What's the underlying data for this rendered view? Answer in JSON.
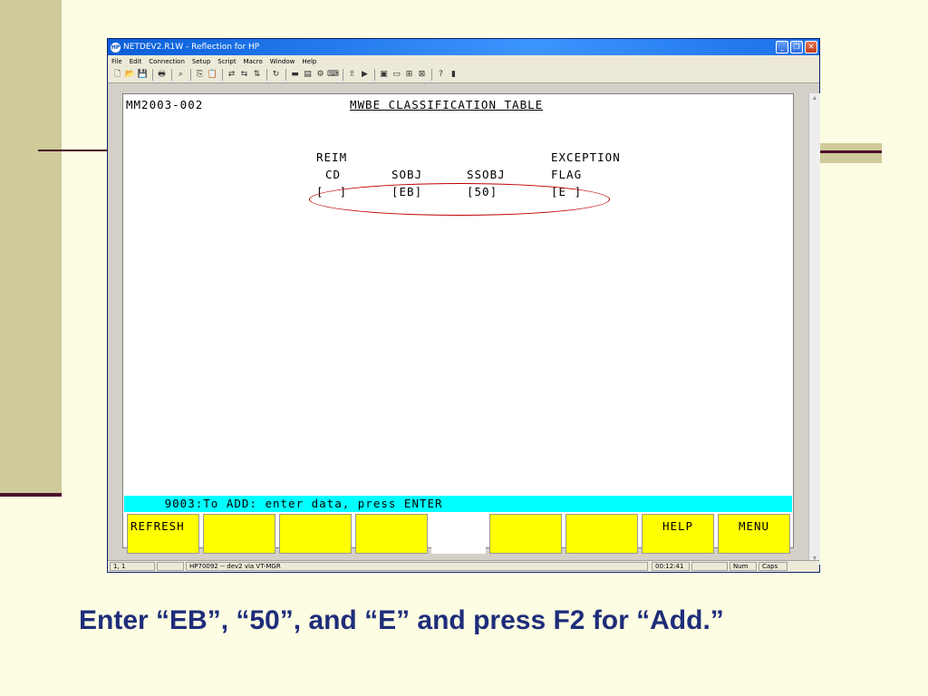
{
  "window": {
    "title": "NETDEV2.R1W - Reflection for HP",
    "icon_label": "HP"
  },
  "menubar": {
    "items": [
      "File",
      "Edit",
      "Connection",
      "Setup",
      "Script",
      "Macro",
      "Window",
      "Help"
    ]
  },
  "terminal": {
    "screen_id": "MM2003-002",
    "screen_title": "MWBE CLASSIFICATION TABLE",
    "columns": [
      {
        "line1": "REIM",
        "line2": "CD",
        "value": "[  ]"
      },
      {
        "line1": "",
        "line2": "SOBJ",
        "value": "[EB]"
      },
      {
        "line1": "",
        "line2": "SSOBJ",
        "value": "[50]"
      },
      {
        "line1": "EXCEPTION",
        "line2": "FLAG",
        "value": "[E ]"
      }
    ],
    "status_message": "     9003:To ADD: enter data, press ENTER",
    "function_keys": [
      "REFRESH",
      "",
      "",
      "",
      "",
      "",
      "",
      "HELP",
      "MENU"
    ]
  },
  "statusbar": {
    "cursor": "1, 1",
    "connection": "HP70092 -- dev2 via VT-MGR",
    "clock": "00:12:41",
    "num": "Num",
    "caps": "Caps"
  },
  "caption": "Enter “EB”, “50”, and “E” and press F2 for “Add.”",
  "colors": {
    "status_line": "#00ffff",
    "function_key": "#ffff00",
    "annotation_oval": "#c00000",
    "caption_text": "#1f2d7a"
  }
}
